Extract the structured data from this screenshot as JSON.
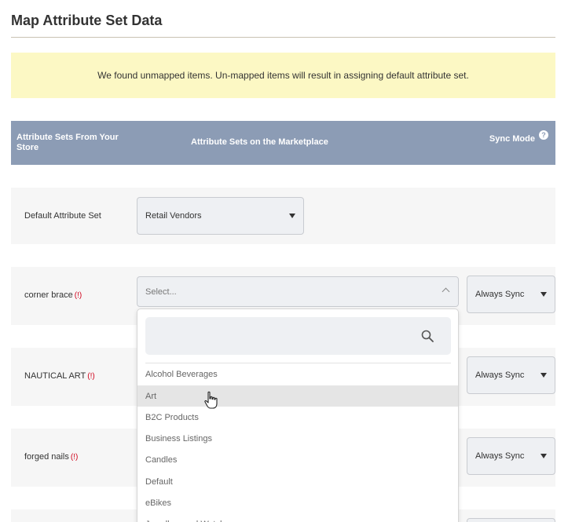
{
  "page": {
    "title": "Map Attribute Set Data"
  },
  "notice": {
    "text": "We found unmapped items. Un-mapped items will result in assigning default attribute set."
  },
  "table": {
    "headers": {
      "store": "Attribute Sets From Your Store",
      "marketplace": "Attribute Sets on the Marketplace",
      "sync_mode": "Sync Mode",
      "help_glyph": "?"
    },
    "error_marker": "(!)",
    "rows": [
      {
        "label": "Default Attribute Set",
        "marketplace_value": "Retail Vendors",
        "sync_mode": ""
      },
      {
        "label": "corner brace",
        "marketplace_value": "Select...",
        "sync_mode": "Always Sync"
      },
      {
        "label": "NAUTICAL ART",
        "marketplace_value": "",
        "sync_mode": "Always Sync"
      },
      {
        "label": "forged nails",
        "marketplace_value": "",
        "sync_mode": "Always Sync"
      }
    ]
  },
  "dropdown": {
    "search_value": "",
    "options": [
      "Alcohol Beverages",
      "Art",
      "B2C Products",
      "Business Listings",
      "Candles",
      "Default",
      "eBikes",
      "Jewellery and Watches"
    ],
    "hovered_index": 1
  },
  "icons": {
    "help": "question-circle-icon",
    "search": "magnifier-icon",
    "cursor": "hand-pointer-icon"
  },
  "colors": {
    "header_bg": "#8c9cb5",
    "notice_bg": "#fcf8c4",
    "error": "#d0021b"
  }
}
